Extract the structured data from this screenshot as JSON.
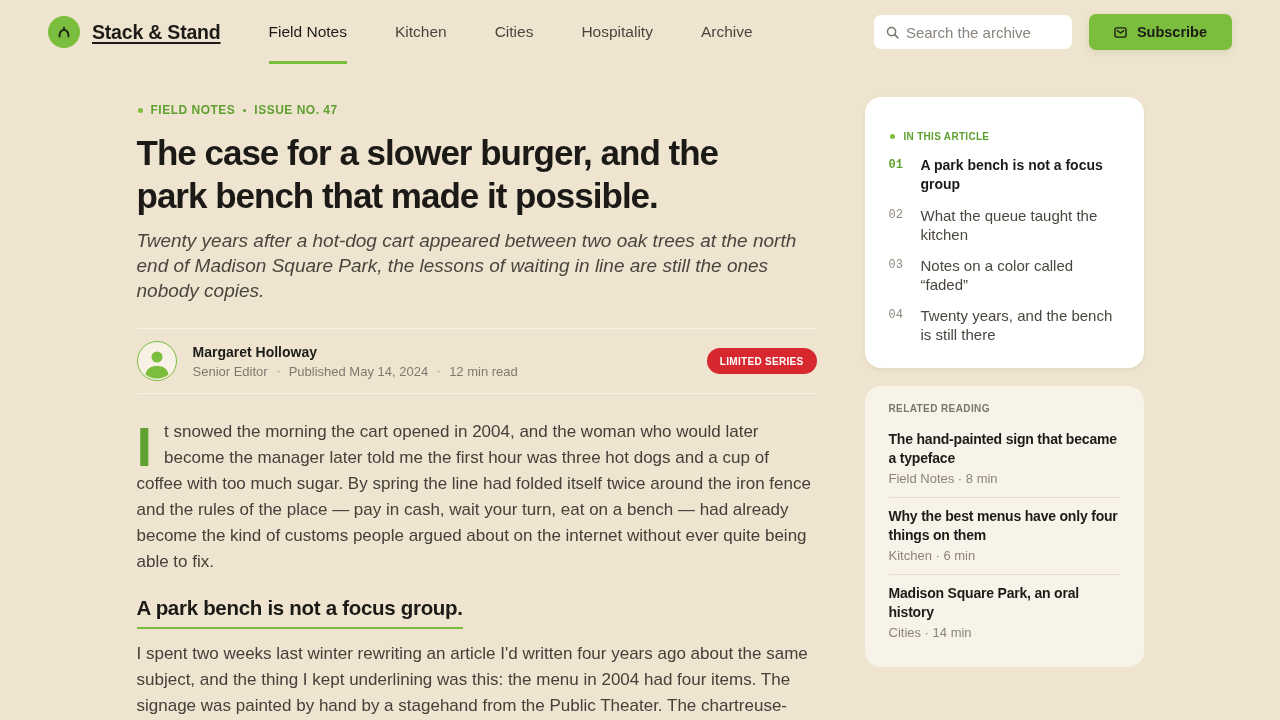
{
  "header": {
    "brand": "Stack & Stand",
    "nav": [
      {
        "label": "Field Notes",
        "selected": true
      },
      {
        "label": "Kitchen",
        "selected": false
      },
      {
        "label": "Cities",
        "selected": false
      },
      {
        "label": "Hospitality",
        "selected": false
      },
      {
        "label": "Archive",
        "selected": false
      }
    ],
    "search": {
      "placeholder": "Search the archive"
    },
    "subscribe_button": "Subscribe"
  },
  "article": {
    "kicker": [
      "FIELD NOTES",
      "ISSUE NO. 47"
    ],
    "title": "The case for a slower burger, and the park bench that made it possible.",
    "dek": "Twenty years after a hot-dog cart appeared between two oak trees at the north end of Madison Square Park, the lessons of waiting in line are still the ones nobody copies.",
    "byline": {
      "author": "Margaret Holloway",
      "meta": [
        "Senior Editor",
        "Published May 14, 2024",
        "12 min read"
      ]
    },
    "badge": "LIMITED SERIES",
    "body": [
      {
        "kind": "paragraph",
        "dropcap": true,
        "text": "It snowed the morning the cart opened in 2004, and the woman who would later become the manager later told me the first hour was three hot dogs and a cup of coffee with too much sugar. By spring the line had folded itself twice around the iron fence and the rules of the place — pay in cash, wait your turn, eat on a bench — had already become the kind of customs people argued about on the internet without ever quite being able to fix."
      },
      {
        "kind": "heading",
        "text": "A park bench is not a focus group."
      },
      {
        "kind": "paragraph",
        "dropcap": false,
        "text": "I spent two weeks last winter rewriting an article I'd written four years ago about the same subject, and the thing I kept underlining was this: the menu in 2004 had four items. The signage was painted by hand by a stagehand from the Public Theater. The chartreuse-"
      }
    ]
  },
  "sidebar": {
    "toc": {
      "heading": "IN THIS ARTICLE",
      "items": [
        {
          "number": "01",
          "title": "A park bench is not a focus group",
          "selected": true
        },
        {
          "number": "02",
          "title": "What the queue taught the kitchen",
          "selected": false
        },
        {
          "number": "03",
          "title": "Notes on a color called “faded”",
          "selected": false
        },
        {
          "number": "04",
          "title": "Twenty years, and the bench is still there",
          "selected": false
        }
      ]
    },
    "related": {
      "heading": "RELATED READING",
      "items": [
        {
          "title": "The hand-painted sign that became a typeface",
          "meta": "Field Notes · 8 min"
        },
        {
          "title": "Why the best menus have only four things on them",
          "meta": "Kitchen · 6 min"
        },
        {
          "title": "Madison Square Park, an oral history",
          "meta": "Cities · 14 min"
        }
      ]
    }
  }
}
